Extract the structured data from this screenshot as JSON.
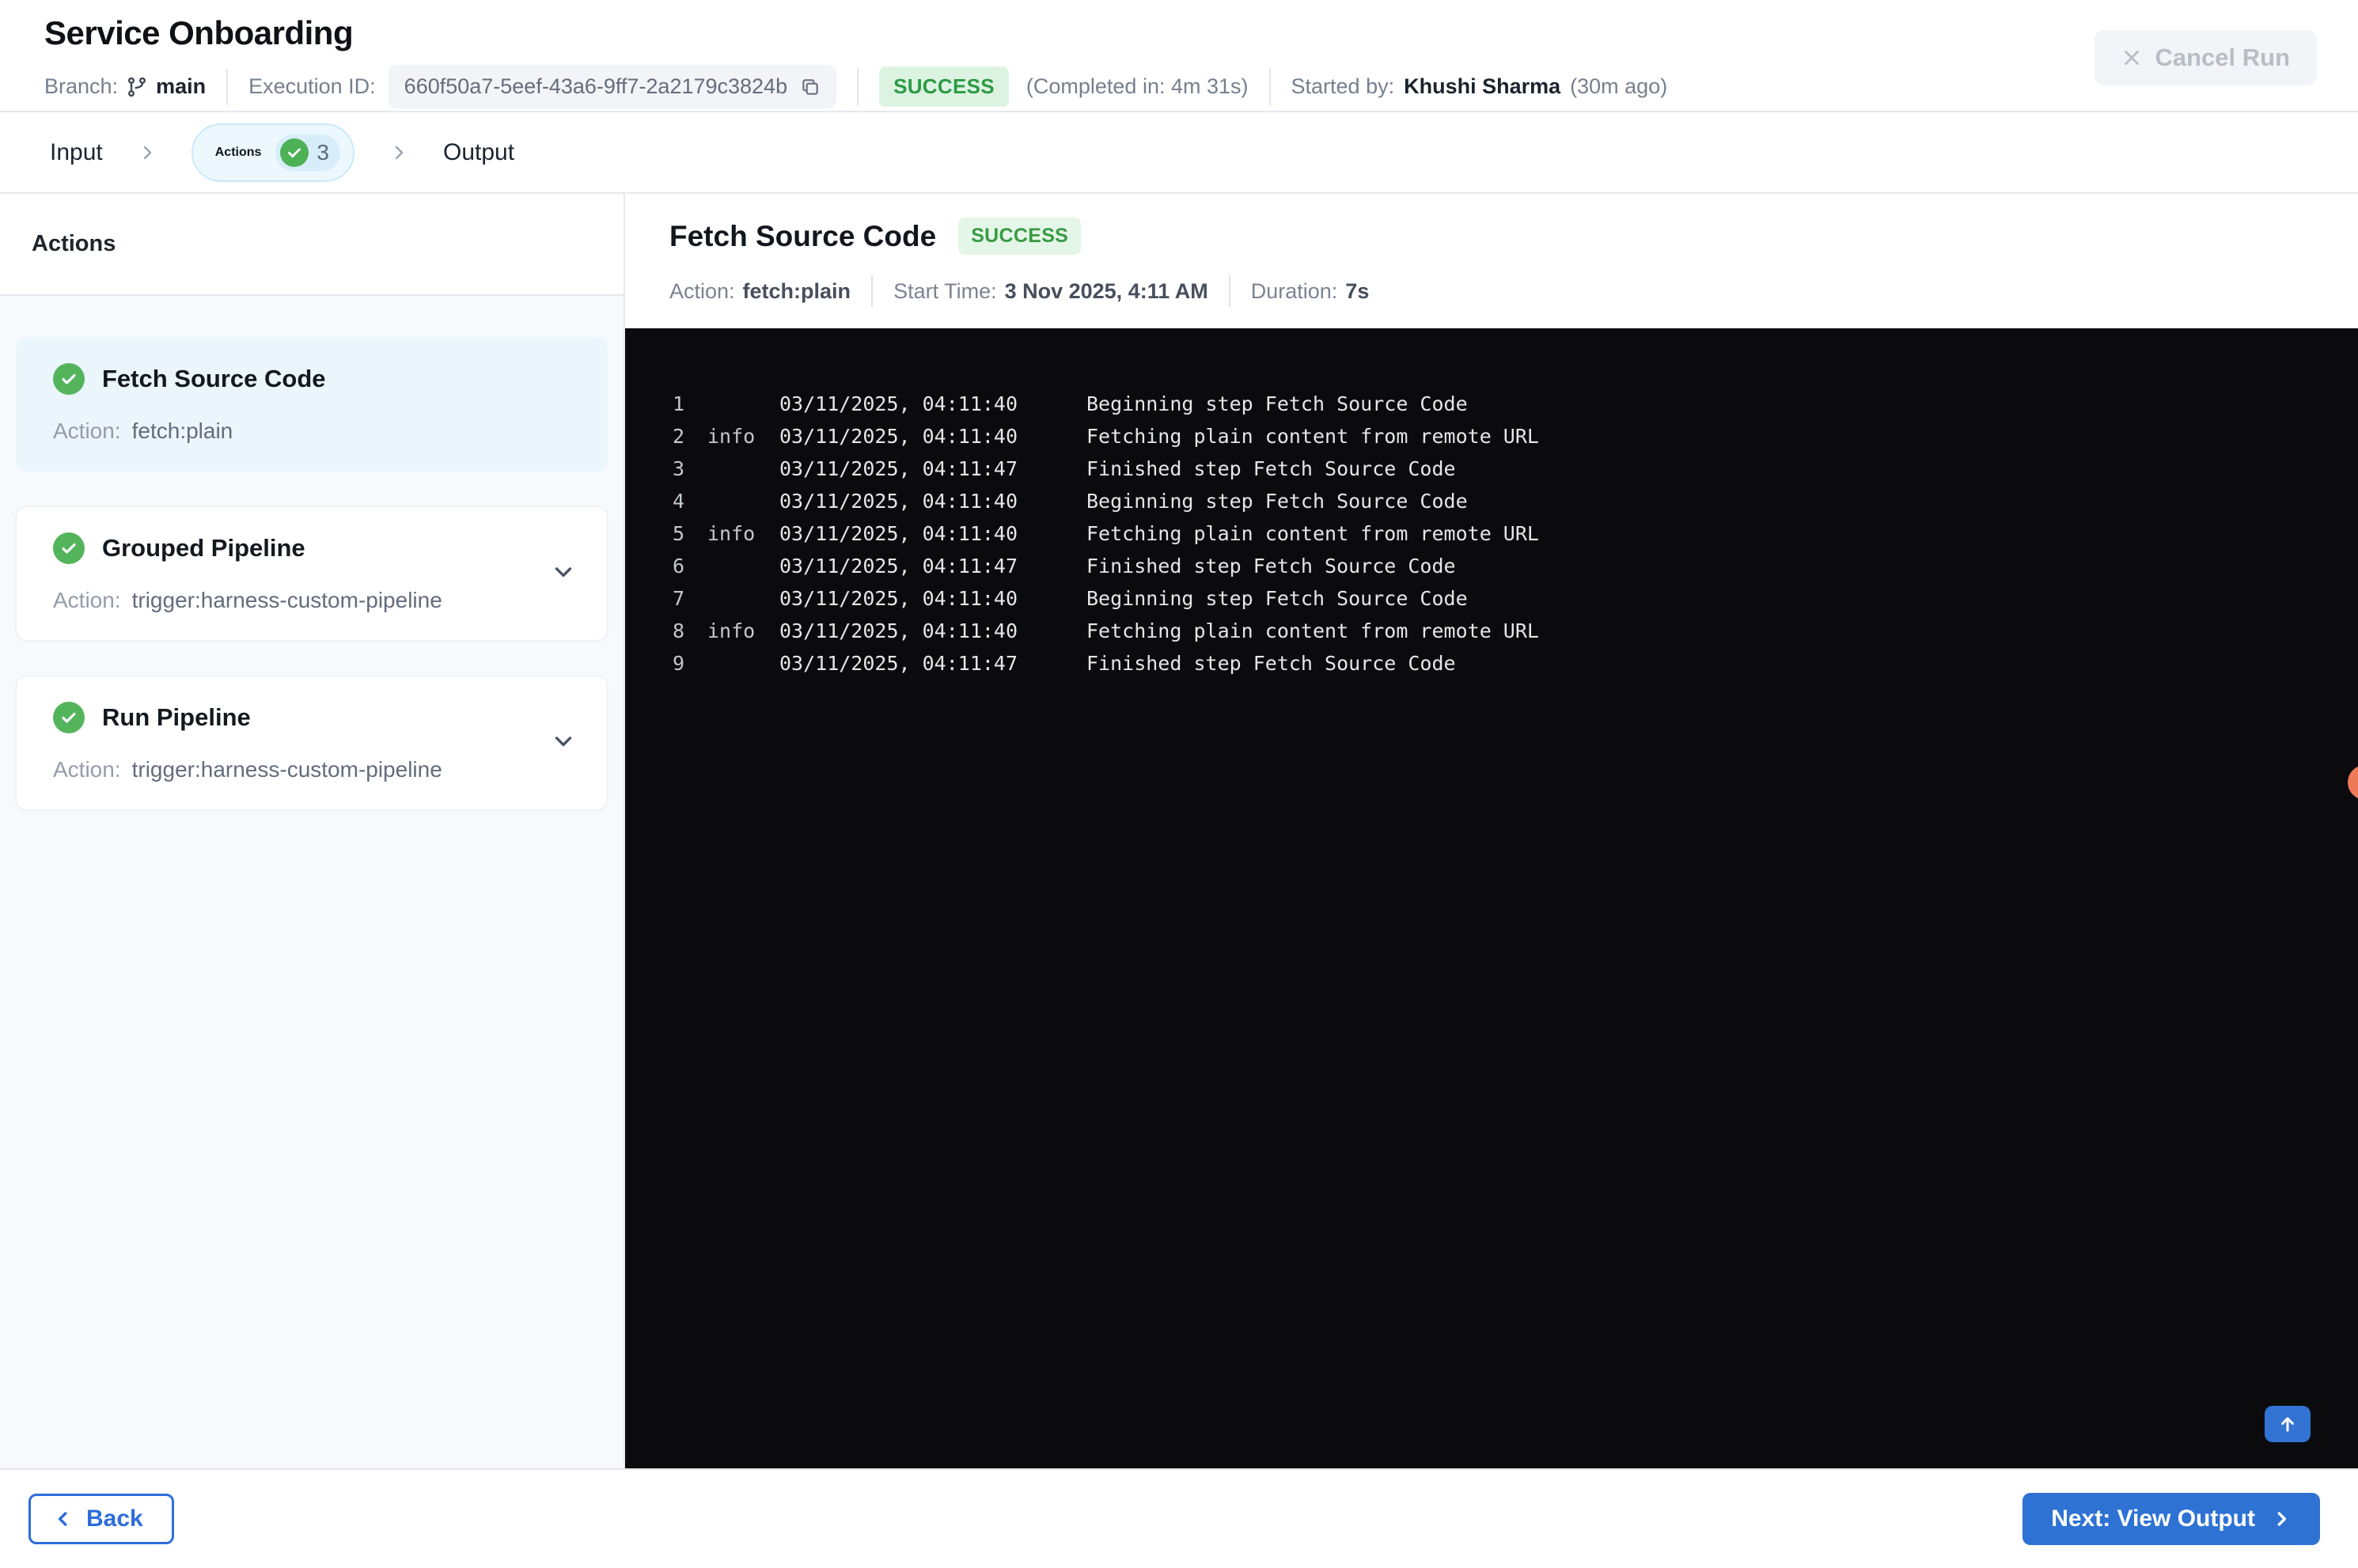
{
  "header": {
    "title": "Service Onboarding",
    "branch_label": "Branch:",
    "branch_value": "main",
    "execution_id_label": "Execution ID:",
    "execution_id_value": "660f50a7-5eef-43a6-9ff7-2a2179c3824b",
    "status_badge": "SUCCESS",
    "completed_in": "(Completed in: 4m 31s)",
    "started_by_label": "Started by:",
    "started_by_name": "Khushi Sharma",
    "started_by_ago": "(30m ago)",
    "cancel_button": "Cancel Run"
  },
  "tabs": {
    "input": "Input",
    "actions": "Actions",
    "actions_count": "3",
    "output": "Output"
  },
  "sidebar": {
    "heading": "Actions",
    "cards": [
      {
        "title": "Fetch Source Code",
        "action_label": "Action:",
        "action_value": "fetch:plain"
      },
      {
        "title": "Grouped Pipeline",
        "action_label": "Action:",
        "action_value": "trigger:harness-custom-pipeline"
      },
      {
        "title": "Run Pipeline",
        "action_label": "Action:",
        "action_value": "trigger:harness-custom-pipeline"
      }
    ]
  },
  "panel": {
    "title": "Fetch Source Code",
    "status_badge": "SUCCESS",
    "action_label": "Action:",
    "action_value": "fetch:plain",
    "start_label": "Start Time:",
    "start_value": "3 Nov 2025, 4:11 AM",
    "duration_label": "Duration:",
    "duration_value": "7s"
  },
  "console": {
    "rows": [
      {
        "num": "1",
        "level": "",
        "time": "03/11/2025, 04:11:40",
        "msg": "Beginning step Fetch Source Code"
      },
      {
        "num": "2",
        "level": "info",
        "time": "03/11/2025, 04:11:40",
        "msg": "Fetching plain content from remote URL"
      },
      {
        "num": "3",
        "level": "",
        "time": "03/11/2025, 04:11:47",
        "msg": "Finished step Fetch Source Code"
      },
      {
        "num": "4",
        "level": "",
        "time": "03/11/2025, 04:11:40",
        "msg": "Beginning step Fetch Source Code"
      },
      {
        "num": "5",
        "level": "info",
        "time": "03/11/2025, 04:11:40",
        "msg": "Fetching plain content from remote URL"
      },
      {
        "num": "6",
        "level": "",
        "time": "03/11/2025, 04:11:47",
        "msg": "Finished step Fetch Source Code"
      },
      {
        "num": "7",
        "level": "",
        "time": "03/11/2025, 04:11:40",
        "msg": "Beginning step Fetch Source Code"
      },
      {
        "num": "8",
        "level": "info",
        "time": "03/11/2025, 04:11:40",
        "msg": "Fetching plain content from remote URL"
      },
      {
        "num": "9",
        "level": "",
        "time": "03/11/2025, 04:11:47",
        "msg": "Finished step Fetch Source Code"
      }
    ]
  },
  "footer": {
    "back_button": "Back",
    "next_button": "Next: View Output"
  },
  "colors": {
    "accent_blue": "#2e72d4",
    "success_green": "#4db156",
    "success_badge_bg": "#ddf3e2",
    "success_badge_text": "#2c9a44",
    "console_bg": "#0b0b0d",
    "orange_dot": "#ee7a58",
    "selected_card_bg": "#ebf5fc"
  }
}
